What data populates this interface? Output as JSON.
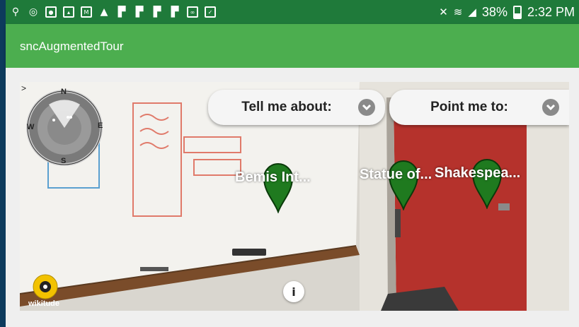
{
  "status_bar": {
    "battery": "38%",
    "time": "2:32 PM"
  },
  "app_bar": {
    "title": "sncAugmentedTour"
  },
  "ar": {
    "tell_me_about": "Tell me about:",
    "point_me_to": "Point me to:",
    "pois": [
      {
        "label": "Bemis Int..."
      },
      {
        "label": "Statue of..."
      },
      {
        "label": "Shakespea..."
      }
    ],
    "info_label": "i",
    "brand": "wikitude",
    "radar": {
      "north": "N",
      "south": "S",
      "east": "E",
      "west": "W",
      "arrow": ">"
    }
  },
  "colors": {
    "status_bar": "#1f7a3a",
    "app_bar": "#4cae4f",
    "pin": "#1f7a1f",
    "door": "#b5322c"
  }
}
